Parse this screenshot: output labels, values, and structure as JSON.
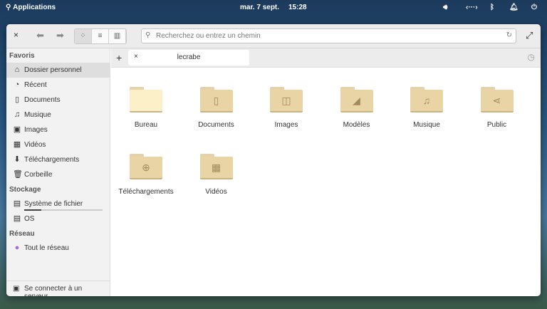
{
  "topbar": {
    "apps": "Applications",
    "date": "mar. 7 sept.",
    "time": "15:28"
  },
  "toolbar": {
    "search_placeholder": "Recherchez ou entrez un chemin"
  },
  "tab": {
    "label": "lecrabe"
  },
  "sidebar": {
    "favoris": "Favoris",
    "items": [
      {
        "label": "Dossier personnel",
        "icon": "⌂"
      },
      {
        "label": "Récent",
        "icon": "◔"
      },
      {
        "label": "Documents",
        "icon": "▯"
      },
      {
        "label": "Musique",
        "icon": "♫"
      },
      {
        "label": "Images",
        "icon": "▣"
      },
      {
        "label": "Vidéos",
        "icon": "▦"
      },
      {
        "label": "Téléchargements",
        "icon": "⬇"
      },
      {
        "label": "Corbeille",
        "icon": "🗑"
      }
    ],
    "stockage": "Stockage",
    "storage": [
      {
        "label": "Système de fichier",
        "usage": 0.22
      },
      {
        "label": "OS"
      }
    ],
    "reseau": "Réseau",
    "network": [
      {
        "label": "Tout le réseau"
      }
    ],
    "connect": "Se connecter à un serveur..."
  },
  "folders": [
    {
      "label": "Bureau",
      "icon": ""
    },
    {
      "label": "Documents",
      "icon": "▯"
    },
    {
      "label": "Images",
      "icon": "◫"
    },
    {
      "label": "Modèles",
      "icon": "◢"
    },
    {
      "label": "Musique",
      "icon": "♫"
    },
    {
      "label": "Public",
      "icon": "⋖"
    },
    {
      "label": "Téléchargements",
      "icon": "⊕"
    },
    {
      "label": "Vidéos",
      "icon": "▦"
    }
  ]
}
